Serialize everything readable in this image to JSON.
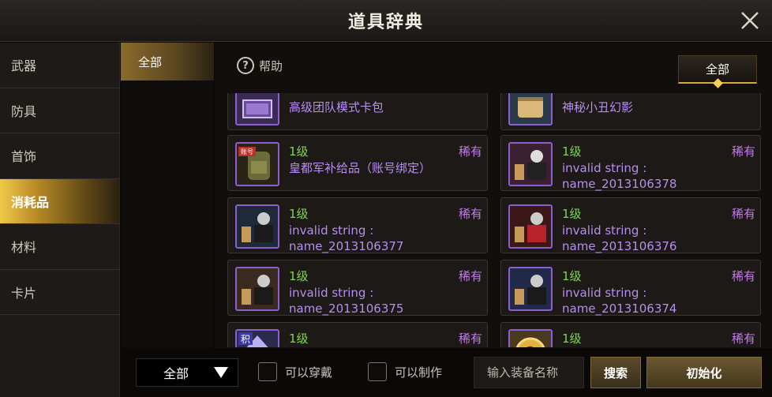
{
  "window": {
    "title": "道具辞典"
  },
  "sidebar": {
    "items": [
      {
        "label": "武器"
      },
      {
        "label": "防具"
      },
      {
        "label": "首饰"
      },
      {
        "label": "消耗品",
        "active": true
      },
      {
        "label": "材料"
      },
      {
        "label": "卡片"
      }
    ]
  },
  "subnav": {
    "items": [
      {
        "label": "全部",
        "active": true
      }
    ]
  },
  "toolbar": {
    "help_label": "帮助",
    "help_icon": "?",
    "filter_label": "全部"
  },
  "items": [
    {
      "level": "",
      "rarity": "",
      "name": "高级团队模式卡包",
      "icon": "card-pack-icon"
    },
    {
      "level": "",
      "rarity": "",
      "name": "神秘小丑幻影",
      "icon": "scroll-icon"
    },
    {
      "level": "1级",
      "rarity": "稀有",
      "name": "皇都军补给品（账号绑定）",
      "icon": "supply-bag-icon",
      "icon_badge": "账号"
    },
    {
      "level": "1级",
      "rarity": "稀有",
      "name": "invalid string : name_2013106378",
      "icon": "gift-box-icon"
    },
    {
      "level": "1级",
      "rarity": "稀有",
      "name": "invalid string : name_2013106377",
      "icon": "gift-box-icon"
    },
    {
      "level": "1级",
      "rarity": "稀有",
      "name": "invalid string : name_2013106376",
      "icon": "gift-box-icon"
    },
    {
      "level": "1级",
      "rarity": "稀有",
      "name": "invalid string : name_2013106375",
      "icon": "gift-box-icon"
    },
    {
      "level": "1级",
      "rarity": "稀有",
      "name": "invalid string : name_2013106374",
      "icon": "gift-box-icon"
    },
    {
      "level": "1级",
      "rarity": "稀有",
      "name": "",
      "icon": "crystal-icon",
      "icon_badge": "积"
    },
    {
      "level": "1级",
      "rarity": "稀有",
      "name": "",
      "icon": "mystery-coin-icon",
      "icon_badge": "?"
    }
  ],
  "bottom": {
    "select_value": "全部",
    "checkbox_wearable": "可以穿戴",
    "checkbox_craftable": "可以制作",
    "search_placeholder": "输入装备名称",
    "search_button": "搜索",
    "reset_button": "初始化"
  },
  "colors": {
    "accent_gold": "#d8a93e",
    "level_green": "#7fd84b",
    "rarity_purple": "#c27be8",
    "icon_border": "#8a5fcf"
  }
}
